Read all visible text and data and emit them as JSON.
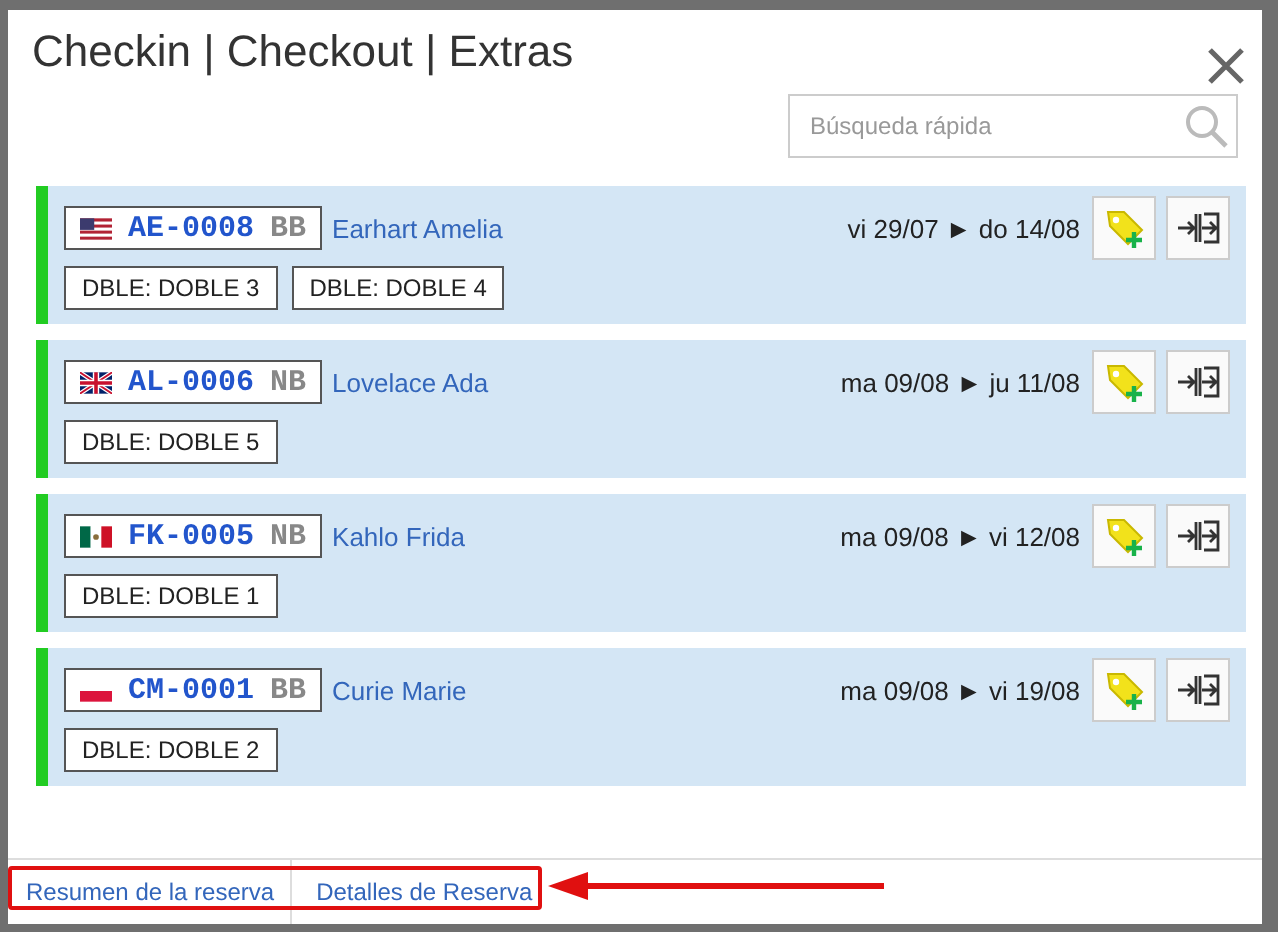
{
  "modal": {
    "title": "Checkin | Checkout | Extras"
  },
  "search": {
    "placeholder": "Búsqueda rápida"
  },
  "bookings": [
    {
      "kind": "us",
      "code": "AE-0008",
      "board": "BB",
      "guest": "Earhart Amelia",
      "dates": "vi 29/07 ► do 14/08",
      "rooms": [
        "DBLE: DOBLE 3",
        "DBLE: DOBLE 4"
      ]
    },
    {
      "kind": "uk",
      "code": "AL-0006",
      "board": "NB",
      "guest": "Lovelace Ada",
      "dates": "ma 09/08 ► ju 11/08",
      "rooms": [
        "DBLE: DOBLE 5"
      ]
    },
    {
      "kind": "mx",
      "code": "FK-0005",
      "board": "NB",
      "guest": "Kahlo Frida",
      "dates": "ma 09/08 ► vi 12/08",
      "rooms": [
        "DBLE: DOBLE 1"
      ]
    },
    {
      "kind": "pl",
      "code": "CM-0001",
      "board": "BB",
      "guest": "Curie Marie",
      "dates": "ma 09/08 ► vi 19/08",
      "rooms": [
        "DBLE: DOBLE 2"
      ]
    }
  ],
  "footer_tabs": [
    {
      "label": "Resumen de la reserva"
    },
    {
      "label": "Detalles de Reserva"
    }
  ]
}
